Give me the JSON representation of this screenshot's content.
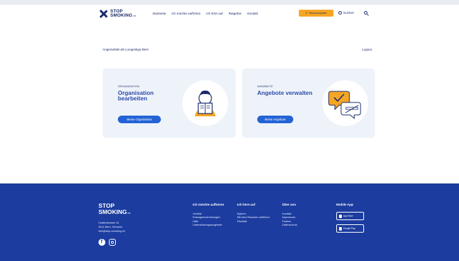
{
  "header": {
    "logo_line1": "STOP",
    "logo_line2": "SMOKING",
    "logo_suffix": ".ch",
    "nav": [
      "Startseite",
      "Ich möchte aufhören",
      "Ich höre auf",
      "Ratgeber",
      "Kontakt"
    ],
    "hotline_label": "Rauchstopplinie",
    "search_label": "Suchen"
  },
  "main": {
    "logged_in": "Angemeldet als Lungenliga Bern",
    "logout": "Logout",
    "cards": [
      {
        "eyebrow": "ORGANISATION",
        "title": "Organisation bearbeiten",
        "button": "Meine Organisation"
      },
      {
        "eyebrow": "ANGEBOTE",
        "title": "Angebote verwalten",
        "button": "Meine Angebote"
      }
    ]
  },
  "footer": {
    "logo_line1": "STOP",
    "logo_line2": "SMOKING",
    "logo_suffix": ".ch",
    "address": [
      "Hodlerstrasse 16",
      "3011 Bern, Schweiz",
      "info@stop-smoking.ch"
    ],
    "col1": {
      "heading": "Ich möchte aufhören",
      "items": [
        "Vorteile",
        "Entzugserscheinungen",
        "Hilfe",
        "Unterstützungsangebote"
      ]
    },
    "col2": {
      "heading": "Ich höre auf",
      "items": [
        "Mythen",
        "Mit dem Rauchen aufhören",
        "Rückfall"
      ]
    },
    "col3": {
      "heading": "Über uns",
      "items": [
        "Kontakt",
        "Impressum",
        "Partner",
        "Datenschutz"
      ]
    },
    "col4": {
      "heading": "Mobile App",
      "stores": [
        "App Store",
        "Google Play"
      ]
    }
  },
  "colors": {
    "primary": "#1c3c9f",
    "button": "#2463d6",
    "accent": "#f5a623",
    "card_bg": "#eef3fa"
  }
}
